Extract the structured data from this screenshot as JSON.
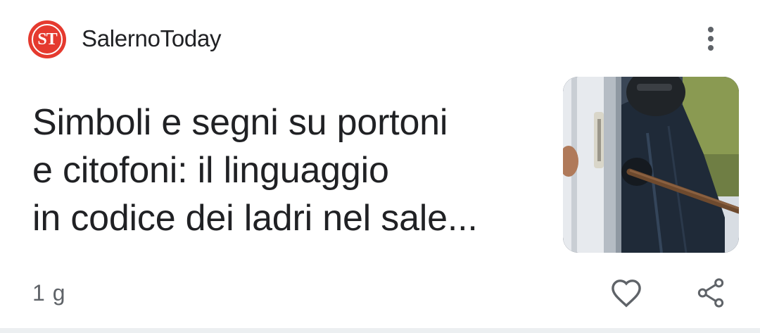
{
  "source": {
    "name": "SalernoToday",
    "logo_text": "ST",
    "logo_color": "#e53a2f"
  },
  "article": {
    "headline_lines": [
      "Simboli e segni su portoni",
      "e citofoni: il linguaggio",
      "in codice dei ladri nel sale..."
    ],
    "thumbnail_icon": "burglar-photo",
    "time_ago": "1 g"
  },
  "actions": {
    "more_icon": "more-vert-icon",
    "like_icon": "heart-outline-icon",
    "share_icon": "share-icon"
  },
  "colors": {
    "text_primary": "#202124",
    "text_secondary": "#5f6368",
    "divider": "#eceff1"
  }
}
